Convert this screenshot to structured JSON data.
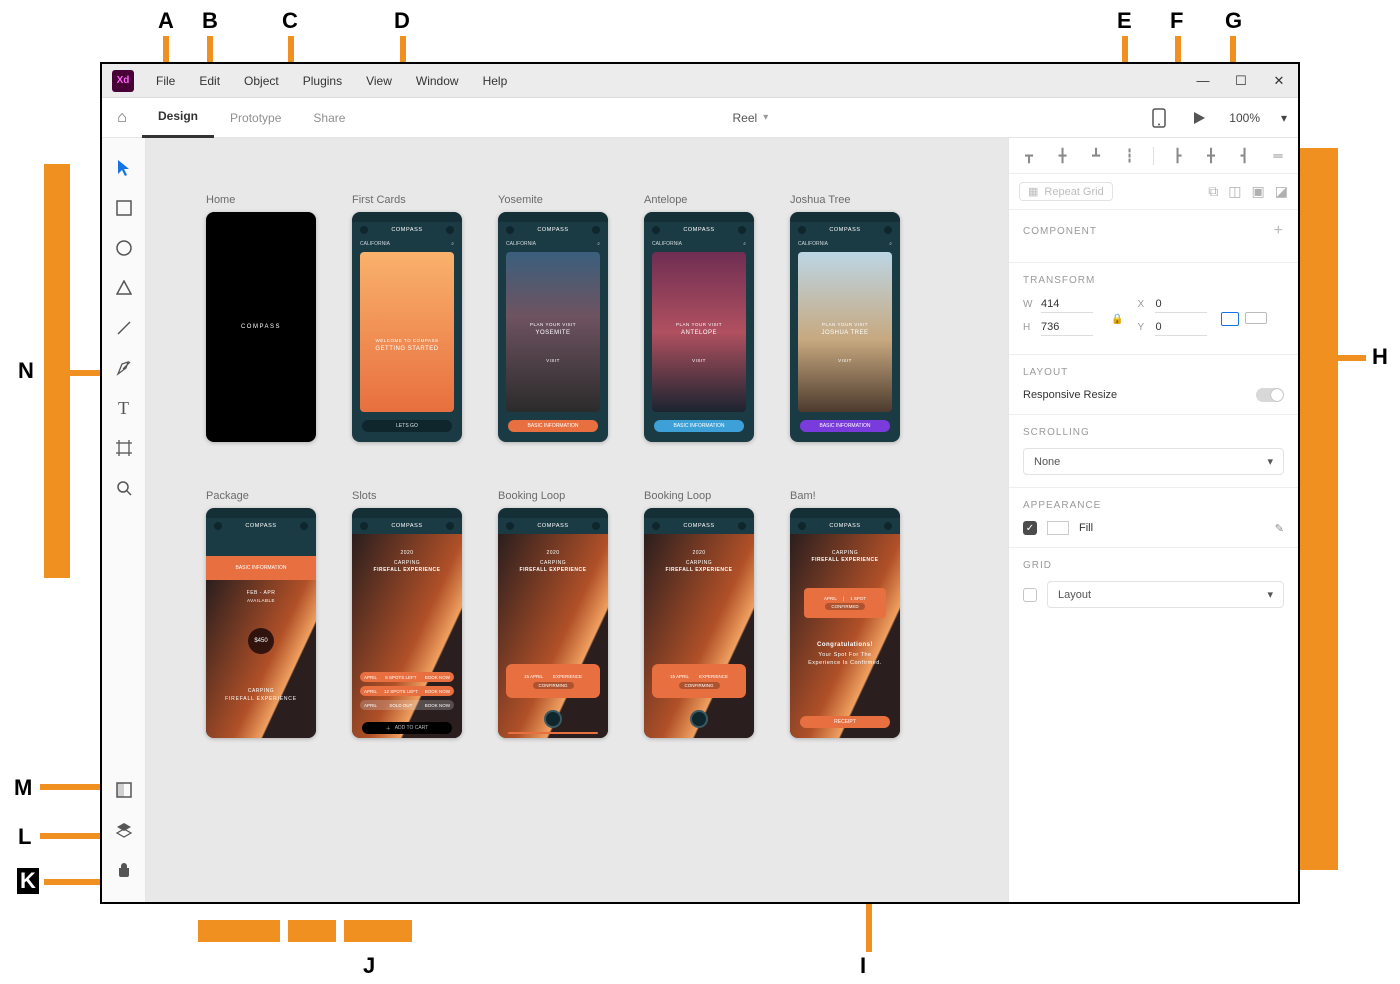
{
  "menu": {
    "file": "File",
    "edit": "Edit",
    "object": "Object",
    "plugins": "Plugins",
    "view": "View",
    "window": "Window",
    "help": "Help"
  },
  "mode": {
    "design": "Design",
    "prototype": "Prototype",
    "share": "Share"
  },
  "doc": {
    "name": "Reel",
    "zoom": "100%"
  },
  "artboards": {
    "row1": [
      {
        "title": "Home",
        "brand": "COMPASS"
      },
      {
        "title": "First Cards",
        "brand": "COMPASS",
        "sub": "CALIFORNIA",
        "h1a": "WELCOME TO COMPASS",
        "h1b": "GETTING STARTED",
        "btn": "LETS GO"
      },
      {
        "title": "Yosemite",
        "brand": "COMPASS",
        "sub": "CALIFORNIA",
        "h1a": "PLAN YOUR VISIT",
        "h1b": "YOSEMITE",
        "btn": "VISIT",
        "bar": "BASIC INFORMATION"
      },
      {
        "title": "Antelope",
        "brand": "COMPASS",
        "sub": "CALIFORNIA",
        "h1a": "PLAN YOUR VISIT",
        "h1b": "ANTELOPE",
        "btn": "VISIT",
        "bar": "BASIC INFORMATION"
      },
      {
        "title": "Joshua Tree",
        "brand": "COMPASS",
        "sub": "CALIFORNIA",
        "h1a": "PLAN YOUR VISIT",
        "h1b": "JOSHUA TREE",
        "btn": "VISIT",
        "bar": "BASIC INFORMATION"
      }
    ],
    "row2": [
      {
        "title": "Package",
        "brand": "COMPASS",
        "bar": "BASIC INFORMATION",
        "date": "FEB - APR",
        "avail": "AVAILABLE",
        "price": "$450",
        "exp1": "CARPING",
        "exp2": "FIREFALL EXPERIENCE"
      },
      {
        "title": "Slots",
        "brand": "COMPASS",
        "yr": "2020",
        "exp1": "CARPING",
        "exp2": "FIREFALL EXPERIENCE",
        "chip1a": "APRIL",
        "chip1b": "6 SPOTS LEFT",
        "chip1c": "BOOK NOW",
        "chip2a": "APRIL",
        "chip2b": "12 SPOTS LEFT",
        "chip2c": "BOOK NOW",
        "chip3a": "APRIL",
        "chip3b": "SOLD OUT",
        "chip3c": "BOOK NOW",
        "add": "ADD TO CART"
      },
      {
        "title": "Booking Loop",
        "brand": "COMPASS",
        "yr": "2020",
        "exp1": "CARPING",
        "exp2": "FIREFALL EXPERIENCE",
        "sel1": "15 APRIL",
        "sel2": "EXPERIENCE",
        "conf": "CONFIRMING"
      },
      {
        "title": "Booking Loop",
        "brand": "COMPASS",
        "yr": "2020",
        "exp1": "CARPING",
        "exp2": "FIREFALL EXPERIENCE",
        "sel1": "15 APRIL",
        "sel2": "EXPERIENCE",
        "conf": "CONFIRMING"
      },
      {
        "title": "Bam!",
        "brand": "COMPASS",
        "exp1": "CARPING",
        "exp2": "FIREFALL EXPERIENCE",
        "tag1": "APRIL",
        "tag2": "1 SPOT",
        "tag3": "CONFIRMED",
        "msg1": "Congratulations!",
        "msg2": "Your Spot For The",
        "msg3": "Experience Is Confirmed.",
        "rcpt": "RECEIPT"
      }
    ]
  },
  "props": {
    "repeat": "Repeat Grid",
    "component": "COMPONENT",
    "transform": {
      "label": "TRANSFORM",
      "w": "W",
      "wval": "414",
      "h": "H",
      "hval": "736",
      "x": "X",
      "xval": "0",
      "y": "Y",
      "yval": "0"
    },
    "layout": {
      "label": "LAYOUT",
      "responsive": "Responsive Resize"
    },
    "scrolling": {
      "label": "SCROLLING",
      "value": "None"
    },
    "appearance": {
      "label": "APPEARANCE",
      "fill": "Fill"
    },
    "grid": {
      "label": "GRID",
      "value": "Layout"
    }
  },
  "callouts": {
    "A": "A",
    "B": "B",
    "C": "C",
    "D": "D",
    "E": "E",
    "F": "F",
    "G": "G",
    "H": "H",
    "I": "I",
    "J": "J",
    "K": "K",
    "L": "L",
    "M": "M",
    "N": "N"
  }
}
